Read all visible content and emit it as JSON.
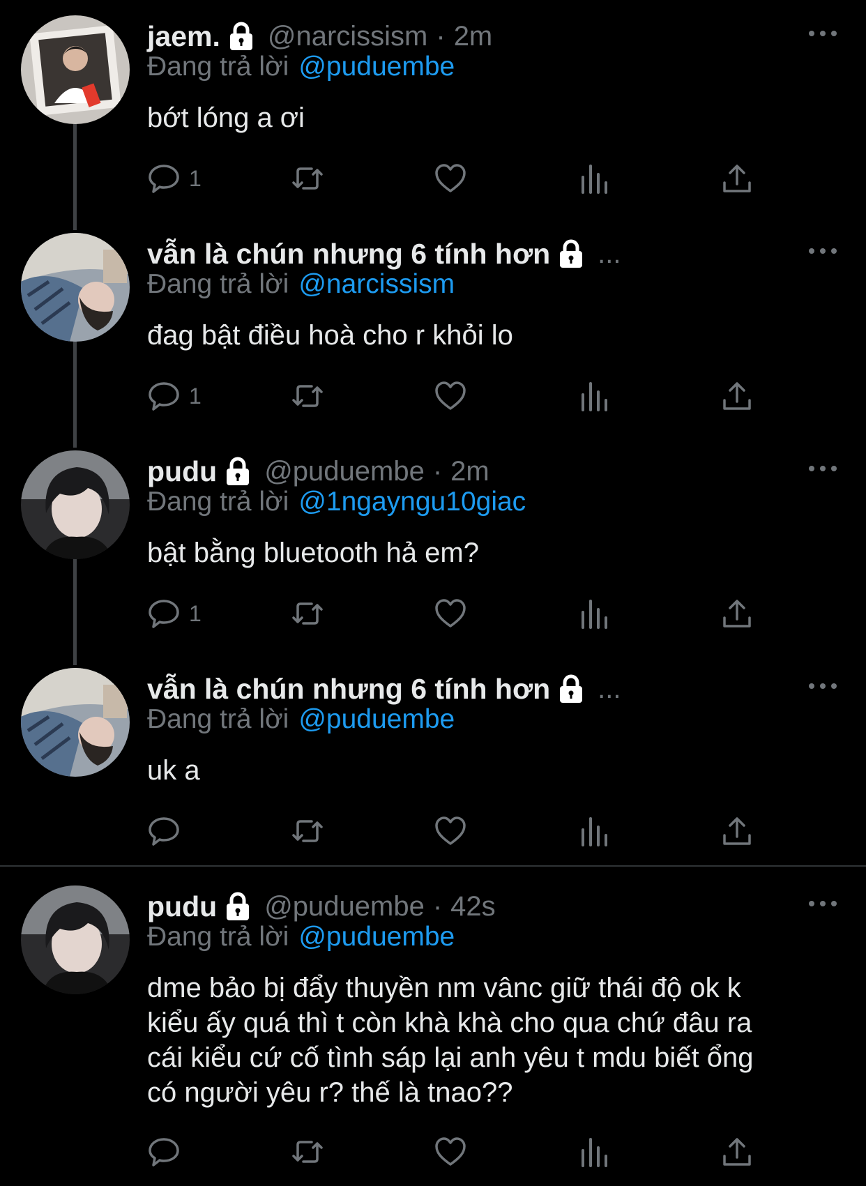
{
  "tweets": [
    {
      "name": "jaem.",
      "locked": true,
      "handle": "@narcissism",
      "time": "2m",
      "replying_label": "Đang trả lời",
      "replying_to": "@puduembe",
      "text": "bớt lóng a ơi",
      "reply_count": "1"
    },
    {
      "name": "vẫn là chún nhưng 6 tính hơn",
      "locked": true,
      "truncated": "...",
      "replying_label": "Đang trả lời",
      "replying_to": "@narcissism",
      "text": "đag bật điều hoà cho r khỏi lo",
      "reply_count": "1"
    },
    {
      "name": "pudu",
      "locked": true,
      "handle": "@puduembe",
      "time": "2m",
      "replying_label": "Đang trả lời",
      "replying_to": "@1ngayngu10giac",
      "text": "bật bằng bluetooth hả em?",
      "reply_count": "1"
    },
    {
      "name": "vẫn là chún nhưng 6 tính hơn",
      "locked": true,
      "truncated": "...",
      "replying_label": "Đang trả lời",
      "replying_to": "@puduembe",
      "text": "uk a",
      "reply_count": ""
    },
    {
      "name": "pudu",
      "locked": true,
      "handle": "@puduembe",
      "time": "42s",
      "replying_label": "Đang trả lời",
      "replying_to": "@puduembe",
      "text_lines": [
        "dme bảo bị đẩy thuyền nm vânc giữ thái độ ok k",
        "kiểu ấy quá thì t còn khà khà cho qua chứ đâu ra",
        "cái kiểu cứ cố tình sáp lại anh yêu t mdu biết ổng",
        "có người yêu r? thế là tnao??"
      ],
      "reply_count": ""
    }
  ],
  "separator": "·",
  "icons": [
    "lock-icon",
    "more-icon",
    "reply-icon",
    "retweet-icon",
    "like-icon",
    "views-icon",
    "share-icon"
  ],
  "colors": {
    "background": "#000000",
    "text": "#e7e9ea",
    "secondary": "#71767b",
    "mention": "#1d9bf0",
    "thread_line": "#3e4144",
    "divider": "#2f3336"
  }
}
